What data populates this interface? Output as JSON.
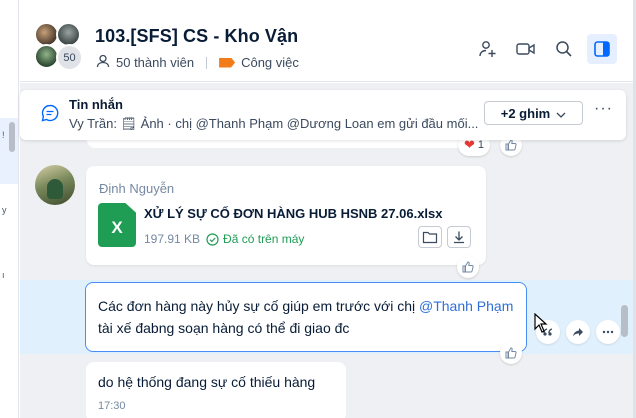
{
  "sidebar_hint": {
    "marks": [
      "!",
      "y",
      "ı"
    ]
  },
  "header": {
    "group_title": "103.[SFS] CS - Kho Vận",
    "avatar_overflow": "50",
    "members": "50 thành viên",
    "category": "Công việc",
    "icons": [
      "add-member-icon",
      "video-call-icon",
      "search-icon",
      "sidebar-toggle-icon"
    ],
    "accent": "#0068ff",
    "category_color": "#f27c19"
  },
  "pinned": {
    "title": "Tin nhắn",
    "preview": "Vy Trần: 🗒 Ảnh · chị @Thanh Phạm @Dương Loan em gửi đầu mối...",
    "pins_label": "+2 ghim",
    "more": "···"
  },
  "prev_message": {
    "reaction_emoji": "❤",
    "reaction_count": "1"
  },
  "file_message": {
    "sender": "Định Nguyễn",
    "file_badge": "X",
    "file_name": "XỬ LÝ SỰ CỐ ĐƠN HÀNG HUB HSNB 27.06.xlsx",
    "file_size": "197.91 KB",
    "status": "Đã có trên máy"
  },
  "active_message": {
    "text_before": "Các đơn hàng này hủy sự cố giúp em trước với chị ",
    "mention": "@Thanh Phạm",
    "text_after": " tài xế đabng soạn hàng có thể đi giao đc"
  },
  "last_message": {
    "text": "do hệ thống đang sự cố thiếu hàng",
    "time": "17:30"
  }
}
